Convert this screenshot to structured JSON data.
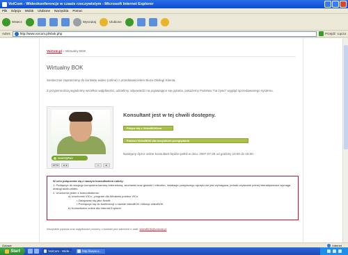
{
  "window": {
    "title": "VoiCom - Wideokonferencje w czasie rzeczywistym - Microsoft Internet Explorer"
  },
  "menu": [
    "Plik",
    "Edycja",
    "Widok",
    "Ulubione",
    "Narzędzia",
    "Pomoc"
  ],
  "toolbar": {
    "back_label": "Wstecz",
    "search_label": "Wyszukaj",
    "favorites_label": "Ulubione"
  },
  "address": {
    "label": "Adres",
    "url": "http://www.voicom.pl/vbok.php",
    "go_label": "Przejdź",
    "links_label": "Łącza"
  },
  "page": {
    "breadcrumb_brand": "VoiCom.pl",
    "breadcrumb_rest": "» Wirtualny BOK",
    "title": "Wirtualny BOK",
    "intro1": "Serdecznie zapraszamy do kontaktu wideo (online) z przedstawicielem Biura Obsługi Klienta.",
    "intro2": "Z przyjemnością wyjaśnimy wszelkie wątpliwości, udzielimy odpowiedzi na pojawiające się pytania, pokażemy Państwu \"na żywo\" wygląd sprzedawanego systemu.",
    "consultant": {
      "status_pill": "DOSTĘPNY",
      "available_text": "Konsultant jest w tej chwili dostępny.",
      "connect_button": "Połącz się z VideoBOKiem",
      "install_button": "Pobierz VideoBOK dla wszystkich przeglądarek",
      "hours_text": "Następny dyżur online konsultant będzie pełnił w dniu: 2007-07-28 od godziny 10:00 do 15:00.",
      "controls": [
        "M+M",
        "◄◄",
        "×",
        "►"
      ]
    },
    "info": {
      "heading": "W celu połączenia się z naszym konsultantem należy:",
      "step1": "Podłączyć do swojego komputera kamerę internetową, słuchawki oraz głośniki i mikrofon, instalacja powyższego sprzętu nie jest wymagana, jednak uzyskanie pełnej interaktywności wymaga obsługi audio-wideo.",
      "step2": "Uruchomić jeden z komunikatorów:",
      "step2a": "Uruchomić VICo - program dla Windows pobierz VICo",
      "step2a_sub1": "Zalogować się jako Nowik",
      "step2a_sub2": "Przełączyć się do konferencji o nazwie videoBOK i kliknąć videoBOK",
      "step2b": "Komunikator online dla Internet Explorer"
    },
    "contact_text": "Wszystkie pytania oraz wątpliwości prosimy o kontakt pod adresem e-mail:",
    "contact_email": "videoBOK@voicom.pl"
  },
  "statusbar": {
    "left": "Gotowe",
    "zone": "Internet"
  },
  "taskbar": {
    "start": "Start",
    "task1": "VoiCom - Wide...",
    "task2": "http://www.v..."
  }
}
